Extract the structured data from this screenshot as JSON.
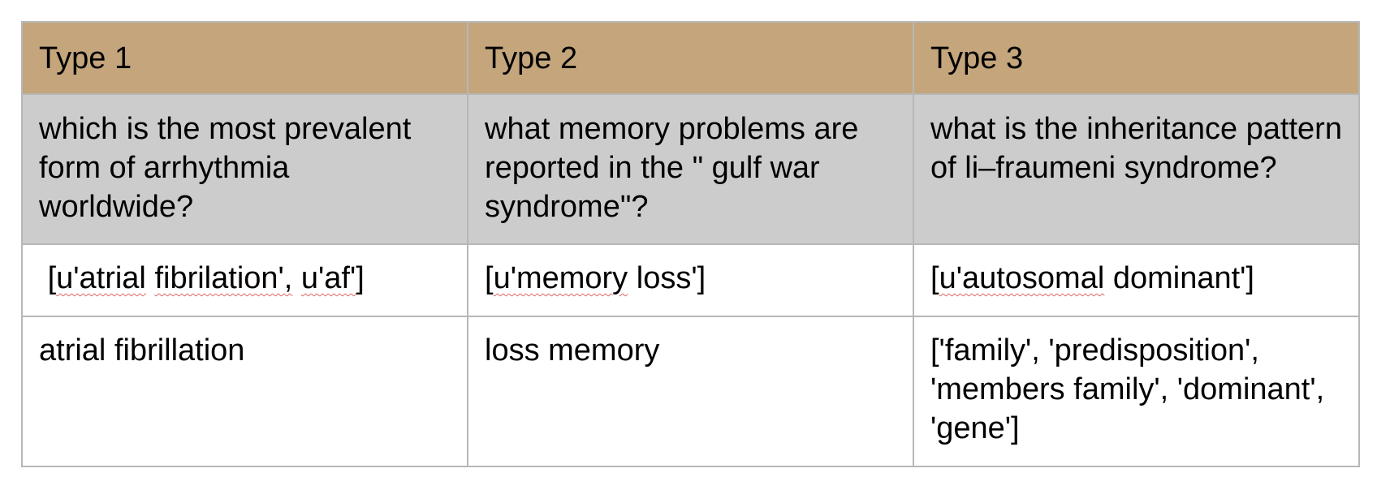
{
  "table": {
    "headers": [
      "Type 1",
      "Type 2",
      "Type 3"
    ],
    "questions": [
      "which is the most prevalent form of arrhythmia worldwide?",
      "what memory problems are reported in the \" gulf war syndrome\"?",
      "what is the inheritance pattern of li–fraumeni syndrome?"
    ],
    "gold_answers": [
      {
        "parts": [
          " [",
          "u'atrial",
          " ",
          "fibrilation',",
          " ",
          "u'af'",
          "]"
        ]
      },
      {
        "parts": [
          "[",
          "u'memory",
          " loss']"
        ]
      },
      {
        "parts": [
          "[",
          "u'autosomal",
          " dominant']"
        ]
      }
    ],
    "predicted_answers": [
      "atrial fibrillation",
      "loss memory",
      "['family', 'predisposition', 'members family', 'dominant', 'gene']"
    ]
  },
  "colors": {
    "header_bg": "#c4a57c",
    "question_bg": "#cccccc",
    "border": "#b7b7b7",
    "spellcheck_underline": "#e06666"
  }
}
